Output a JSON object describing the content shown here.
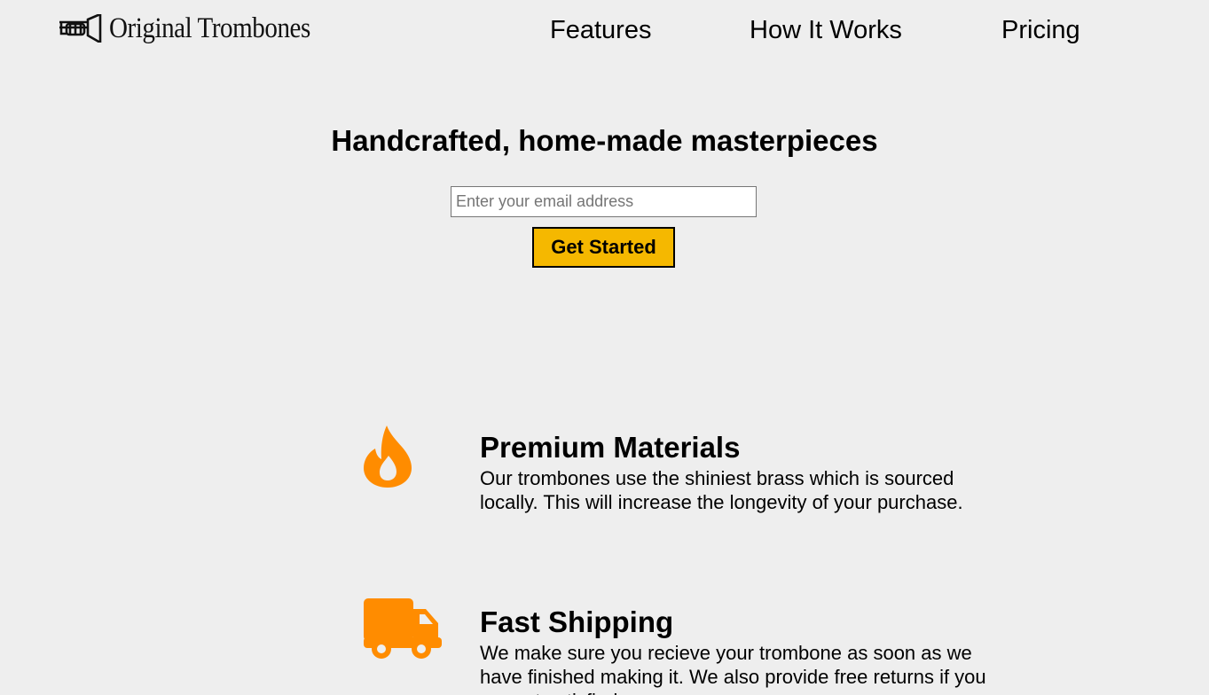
{
  "brand": {
    "name": "Original Trombones",
    "logo_icon": "trombone-icon"
  },
  "nav": {
    "items": [
      {
        "label": "Features"
      },
      {
        "label": "How It Works"
      },
      {
        "label": "Pricing"
      }
    ]
  },
  "hero": {
    "title": "Handcrafted, home-made masterpieces",
    "email_placeholder": "Enter your email address",
    "email_value": "",
    "cta_label": "Get Started"
  },
  "features": [
    {
      "icon": "fire-icon",
      "title": "Premium Materials",
      "description": "Our trombones use the shiniest brass which is sourced locally. This will increase the longevity of your purchase."
    },
    {
      "icon": "truck-icon",
      "title": "Fast Shipping",
      "description": "We make sure you recieve your trombone as soon as we have finished making it. We also provide free returns if you are not satisfied."
    }
  ],
  "colors": {
    "accent_orange": "#ff8c00",
    "button_yellow": "#f5b800",
    "background": "#eeeeee"
  }
}
